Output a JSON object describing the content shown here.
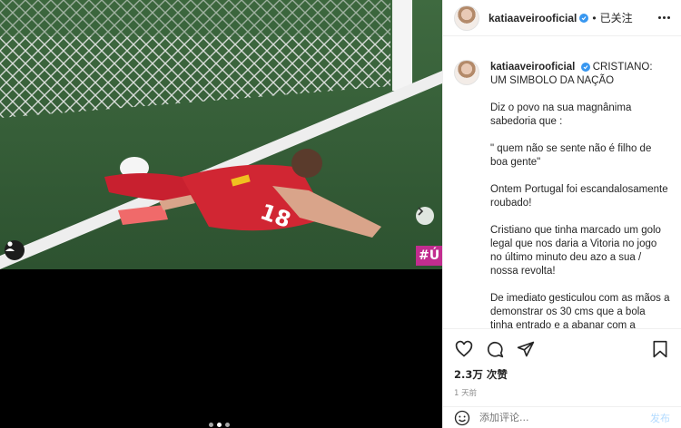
{
  "post": {
    "username": "katiaaveirooficial",
    "follow_dot": "•",
    "follow_status": "已关注",
    "caption": {
      "title_rest": "CRISTIANO: UM SIMBOLO DA NAÇÃO",
      "paragraphs": [
        "Diz o povo na sua magnânima sabedoria que :",
        "\" quem não se sente não é filho de boa gente\"",
        "Ontem Portugal foi escandalosamente roubado!",
        "Cristiano que tinha marcado um golo legal que nos daria a Vitoria no jogo no último minuto deu azo a sua / nossa revolta!",
        "De imediato gesticulou com as mãos a demonstrar os 30 cms que a bola tinha entrado e a abanar com a cabeça que assim não valia a pena continuar"
      ]
    },
    "views": "2.3万 次赞",
    "time_ago": "1 天前",
    "comment_placeholder": "添加评论...",
    "post_button": "发布"
  },
  "media": {
    "watermark": "#Ú",
    "jersey_number": "18",
    "slide_count": 3,
    "active_slide": 2
  },
  "icons": {
    "like": "heart-icon",
    "comment": "comment-icon",
    "share": "share-icon",
    "save": "bookmark-icon",
    "emoji": "emoji-icon",
    "more": "more-options-icon",
    "tag": "user-tag-icon",
    "next": "chevron-right-icon"
  },
  "colors": {
    "verified": "#3897f0",
    "post_disabled": "#b3dbff",
    "jersey": "#c8202f",
    "pitch": "#3a5a3a"
  }
}
